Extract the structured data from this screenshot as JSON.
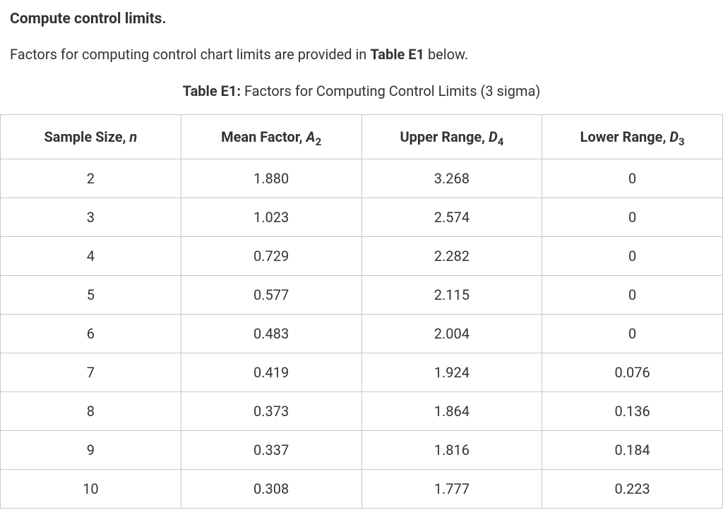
{
  "heading": "Compute control limits.",
  "intro": {
    "prefix": "Factors for computing control chart limits are provided in ",
    "bold": "Table E1",
    "suffix": " below."
  },
  "caption": {
    "bold": "Table E1:",
    "rest": " Factors for Computing Control Limits (3 sigma)"
  },
  "headers": {
    "col0_prefix": "Sample Size, ",
    "col0_var": "n",
    "col1_prefix": "Mean Factor, ",
    "col1_var": "A",
    "col1_sub": "2",
    "col2_prefix": "Upper Range, ",
    "col2_var": "D",
    "col2_sub": "4",
    "col3_prefix": "Lower Range, ",
    "col3_var": "D",
    "col3_sub": "3"
  },
  "chart_data": {
    "type": "table",
    "columns": [
      "Sample Size, n",
      "Mean Factor, A2",
      "Upper Range, D4",
      "Lower Range, D3"
    ],
    "rows": [
      {
        "n": "2",
        "a2": "1.880",
        "d4": "3.268",
        "d3": "0"
      },
      {
        "n": "3",
        "a2": "1.023",
        "d4": "2.574",
        "d3": "0"
      },
      {
        "n": "4",
        "a2": "0.729",
        "d4": "2.282",
        "d3": "0"
      },
      {
        "n": "5",
        "a2": "0.577",
        "d4": "2.115",
        "d3": "0"
      },
      {
        "n": "6",
        "a2": "0.483",
        "d4": "2.004",
        "d3": "0"
      },
      {
        "n": "7",
        "a2": "0.419",
        "d4": "1.924",
        "d3": "0.076"
      },
      {
        "n": "8",
        "a2": "0.373",
        "d4": "1.864",
        "d3": "0.136"
      },
      {
        "n": "9",
        "a2": "0.337",
        "d4": "1.816",
        "d3": "0.184"
      },
      {
        "n": "10",
        "a2": "0.308",
        "d4": "1.777",
        "d3": "0.223"
      }
    ]
  }
}
